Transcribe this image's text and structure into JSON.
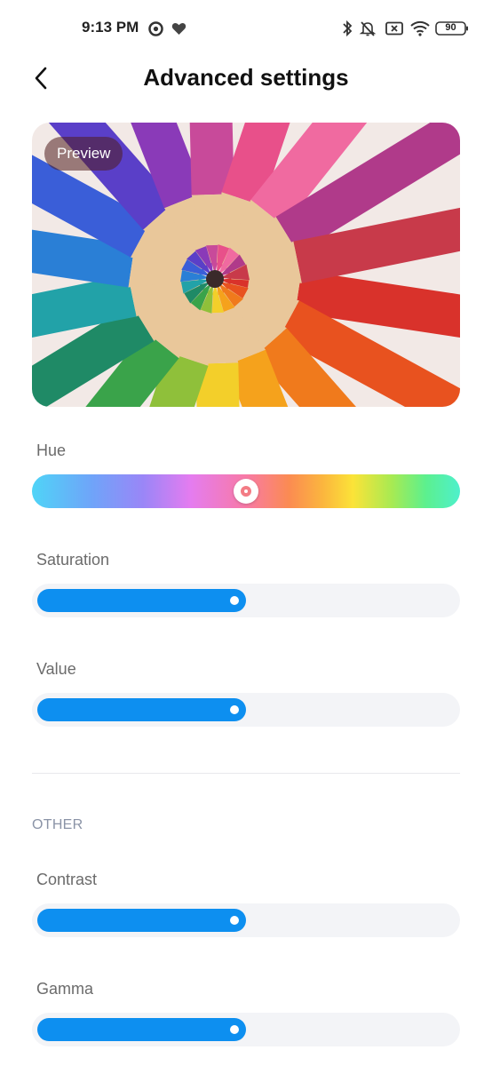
{
  "status_bar": {
    "time": "9:13 PM",
    "battery": "90",
    "icons": [
      "record-icon",
      "heart-icon",
      "bluetooth-icon",
      "silent-bell-icon",
      "screen-x-icon",
      "wifi-icon",
      "battery-icon"
    ]
  },
  "header": {
    "title": "Advanced settings",
    "back_icon": "back-arrow-icon"
  },
  "preview": {
    "badge": "Preview"
  },
  "sliders": {
    "hue": {
      "label": "Hue",
      "value": 0.5
    },
    "saturation": {
      "label": "Saturation",
      "value": 0.5
    },
    "value": {
      "label": "Value",
      "value": 0.5
    }
  },
  "other": {
    "header": "OTHER",
    "contrast": {
      "label": "Contrast",
      "value": 0.5
    },
    "gamma": {
      "label": "Gamma",
      "value": 0.5
    }
  },
  "colors": {
    "accent": "#0d8ff0",
    "track": "#f3f4f7"
  }
}
